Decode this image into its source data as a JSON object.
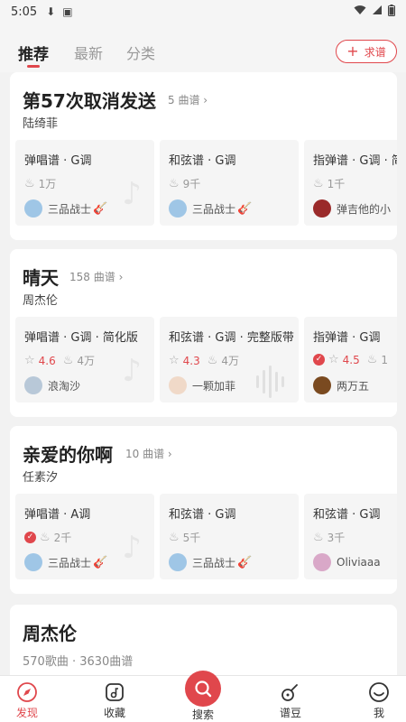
{
  "status": {
    "time": "5:05"
  },
  "tabs": [
    {
      "label": "推荐",
      "active": true
    },
    {
      "label": "最新",
      "active": false
    },
    {
      "label": "分类",
      "active": false
    }
  ],
  "request_button": "求谱",
  "cards": [
    {
      "title": "第57次取消发送",
      "count": "5 曲谱",
      "artist": "陆绮菲",
      "tiles": [
        {
          "title": "弹唱谱 · G调",
          "likes": "1万",
          "user": "三品战士",
          "guitar": true
        },
        {
          "title": "和弦谱 · G调",
          "likes": "9千",
          "user": "三品战士",
          "guitar": true
        },
        {
          "title": "指弹谱 · G调 · 简",
          "likes": "1千",
          "user": "弹吉他的小"
        }
      ]
    },
    {
      "title": "晴天",
      "count": "158 曲谱",
      "artist": "周杰伦",
      "tiles": [
        {
          "title": "弹唱谱 · G调 · 简化版",
          "rating": "4.6",
          "likes": "4万",
          "user": "浪淘沙"
        },
        {
          "title": "和弦谱 · G调 · 完整版带",
          "rating": "4.3",
          "likes": "4万",
          "user": "一颗加菲"
        },
        {
          "title": "指弹谱 · G调",
          "verified": true,
          "rating": "4.5",
          "likes": "1",
          "user": "两万五"
        }
      ]
    },
    {
      "title": "亲爱的你啊",
      "count": "10 曲谱",
      "artist": "任素汐",
      "tiles": [
        {
          "title": "弹唱谱 · A调",
          "verified": true,
          "likes": "2千",
          "user": "三品战士",
          "guitar": true
        },
        {
          "title": "和弦谱 · G调",
          "likes": "5千",
          "user": "三品战士",
          "guitar": true
        },
        {
          "title": "和弦谱 · G调",
          "likes": "3千",
          "user": "Oliviaaa"
        }
      ]
    },
    {
      "title": "周杰伦",
      "meta": "570歌曲 · 3630曲谱"
    }
  ],
  "nav": [
    {
      "label": "发现",
      "active": true
    },
    {
      "label": "收藏"
    },
    {
      "label": "搜索"
    },
    {
      "label": "谱豆"
    },
    {
      "label": "我"
    }
  ],
  "colors": {
    "accent": "#e0474c"
  }
}
